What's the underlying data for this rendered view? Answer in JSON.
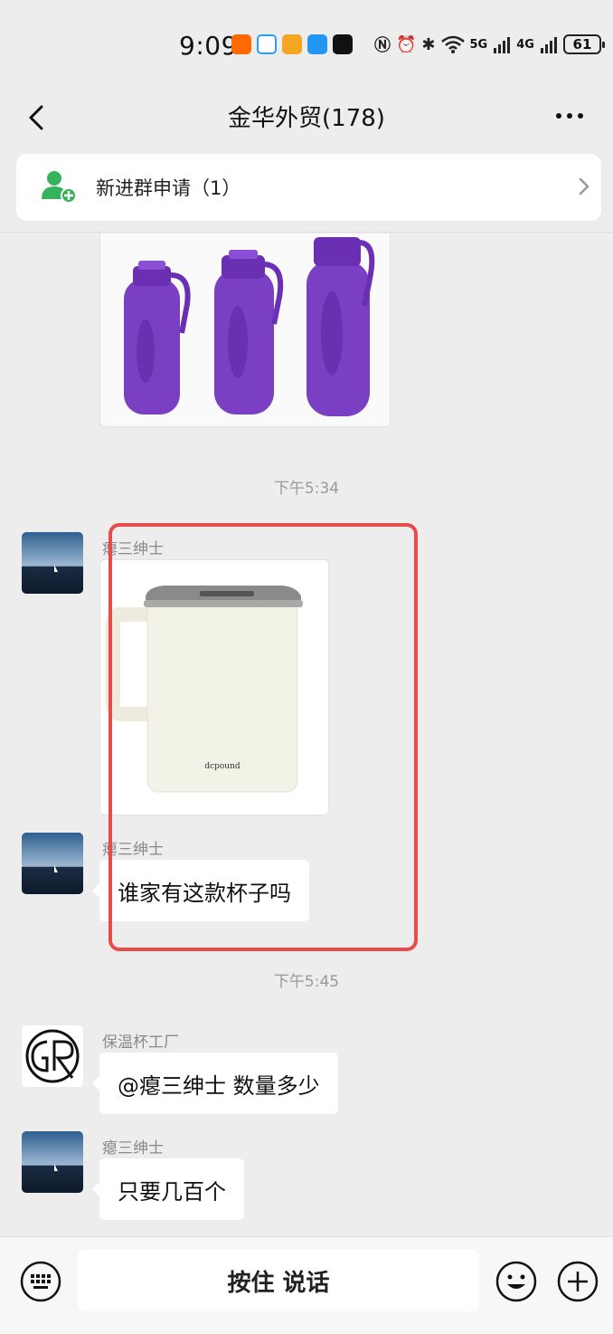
{
  "status_bar": {
    "time": "9:09",
    "network_5g": "5G",
    "network_4g": "4G",
    "battery": "61"
  },
  "header": {
    "title": "金华外贸(178)"
  },
  "banner": {
    "text": "新进群申请（1）"
  },
  "messages": {
    "time_1": "下午5:34",
    "sender_1": "瘪三绅士",
    "sender_2": "瘪三绅士",
    "text_2": "谁家有这款杯子吗",
    "time_2": "下午5:45",
    "sender_3": "保温杯工厂",
    "text_3": "@瘪三绅士  数量多少",
    "sender_4": "瘪三绅士",
    "text_4": "只要几百个",
    "mug_logo": "dcpound"
  },
  "input_bar": {
    "hold_to_talk": "按住 说话"
  },
  "colors": {
    "highlight": "#e94b4b",
    "bottle": "#7b3fc4",
    "banner_icon": "#35b35a"
  }
}
